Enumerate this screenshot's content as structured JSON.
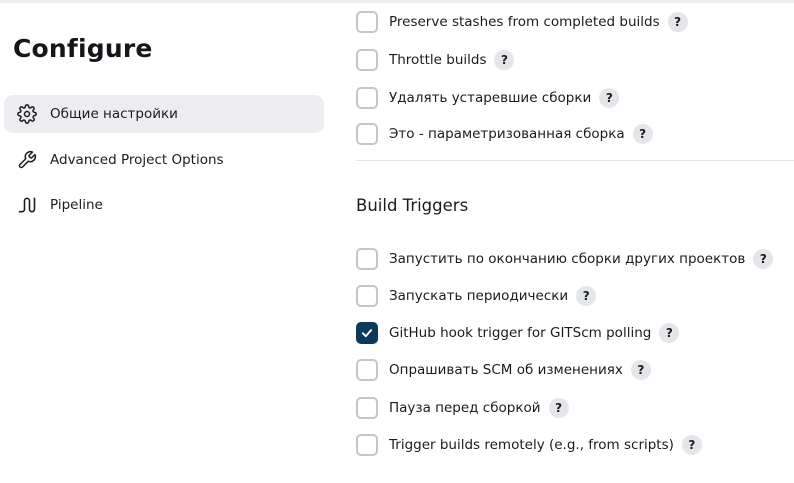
{
  "sidebar": {
    "title": "Configure",
    "items": [
      {
        "label": "Общие настройки",
        "icon": "gear-icon",
        "active": true
      },
      {
        "label": "Advanced Project Options",
        "icon": "wrench-icon",
        "active": false
      },
      {
        "label": "Pipeline",
        "icon": "pipeline-icon",
        "active": false
      }
    ]
  },
  "general": {
    "options": [
      {
        "label": "Preserve stashes from completed builds",
        "checked": false,
        "help": "?"
      },
      {
        "label": "Throttle builds",
        "checked": false,
        "help": "?"
      },
      {
        "label": "Удалять устаревшие сборки",
        "checked": false,
        "help": "?"
      },
      {
        "label": "Это - параметризованная сборка",
        "checked": false,
        "help": "?"
      }
    ]
  },
  "build_triggers": {
    "title": "Build Triggers",
    "options": [
      {
        "label": "Запустить по окончанию сборки других проектов",
        "checked": false,
        "help": "?"
      },
      {
        "label": "Запускать периодически",
        "checked": false,
        "help": "?"
      },
      {
        "label": "GitHub hook trigger for GITScm polling",
        "checked": true,
        "help": "?"
      },
      {
        "label": "Опрашивать SCM об изменениях",
        "checked": false,
        "help": "?"
      },
      {
        "label": "Пауза перед сборкой",
        "checked": false,
        "help": "?"
      },
      {
        "label": "Trigger builds remotely (e.g., from scripts)",
        "checked": false,
        "help": "?"
      }
    ]
  },
  "colors": {
    "checkbox_checked": "#0c3a5a",
    "active_nav_bg": "#ececf1"
  }
}
